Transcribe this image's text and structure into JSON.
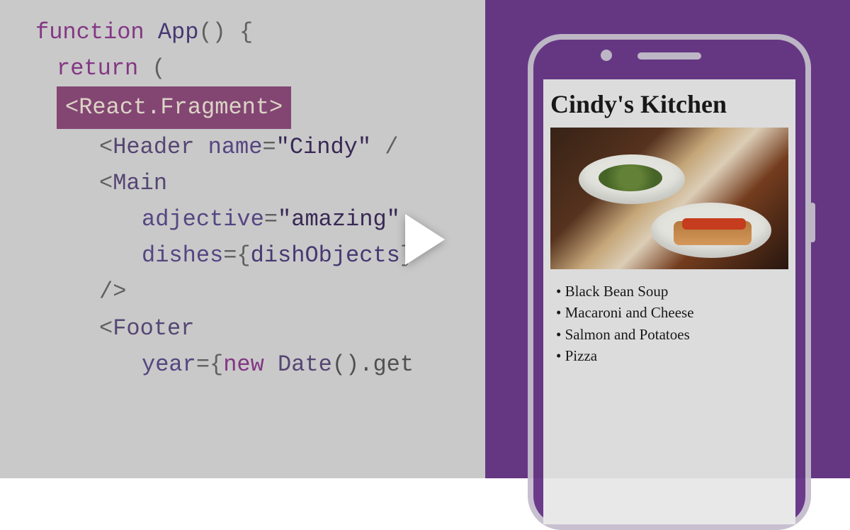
{
  "code": {
    "line1_kw1": "function",
    "line1_fn": "App",
    "line1_parens": "()",
    "line1_brace": " {",
    "line2_kw": "return",
    "line2_paren": " (",
    "line3_highlight": "<React.Fragment>",
    "line4_open": "<",
    "line4_tag": "Header",
    "line4_attr": " name",
    "line4_eq": "=",
    "line4_val": "\"Cindy\"",
    "line4_close": " /",
    "line5_open": "<",
    "line5_tag": "Main",
    "line6_attr": "adjective",
    "line6_eq": "=",
    "line6_val": "\"amazing\"",
    "line7_attr": "dishes",
    "line7_eq": "=",
    "line7_brace_open": "{",
    "line7_val": "dishObjects",
    "line7_brace_close": "}",
    "line8_close": "/>",
    "line9_open": "<",
    "line9_tag": "Footer",
    "line10_attr": "year",
    "line10_eq": "=",
    "line10_brace_open": "{",
    "line10_kw": "new",
    "line10_cls": " Date",
    "line10_call": "().get"
  },
  "app": {
    "title": "Cindy's Kitchen",
    "menu": {
      "item1": "Black Bean Soup",
      "item2": "Macaroni and Cheese",
      "item3": "Salmon and Potatoes",
      "item4": "Pizza"
    }
  }
}
